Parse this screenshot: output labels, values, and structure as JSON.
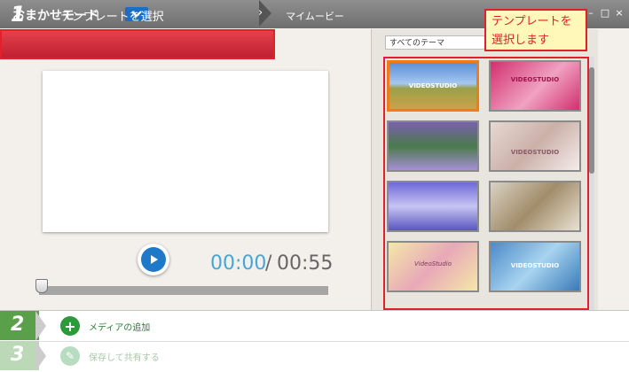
{
  "titlebar": {
    "mode_label": "おまかせモード",
    "window_title": "マイムービー",
    "minimize": "–",
    "maximize": "□",
    "close": "×"
  },
  "step1": {
    "number": "1",
    "label": "テンプレートを選択",
    "chevron": "›"
  },
  "player": {
    "current_time": "00:00",
    "separator": "/",
    "total_time": "00:55",
    "progress": 0
  },
  "themes": {
    "filter_selected": "すべてのテーマ",
    "thumbnails": [
      {
        "text": "VIDEOSTUDIO",
        "selected": true
      },
      {
        "text": "VIDEOSTUDIO",
        "selected": false
      },
      {
        "text": "",
        "selected": false
      },
      {
        "text": "VIDEOSTUDIO",
        "selected": false
      },
      {
        "text": "",
        "selected": false
      },
      {
        "text": "",
        "selected": false
      },
      {
        "text": "VideoStudio",
        "selected": false
      },
      {
        "text": "VIDEOSTUDIO",
        "selected": false
      }
    ]
  },
  "callout": {
    "line1": "テンプレートを",
    "line2": "選択します"
  },
  "steps": [
    {
      "number": "2",
      "label": "メディアの追加",
      "icon": "plus-icon",
      "color": "#2a9a3a"
    },
    {
      "number": "3",
      "label": "保存して共有する",
      "icon": "share-icon",
      "color": "#b7dcbf"
    }
  ],
  "colors": {
    "accent_red": "#e0202a",
    "time_blue": "#48a6d6",
    "play_blue": "#1e7ac8",
    "step_green": "#5aa04a",
    "step_green_inactive": "#bcd9b7"
  }
}
